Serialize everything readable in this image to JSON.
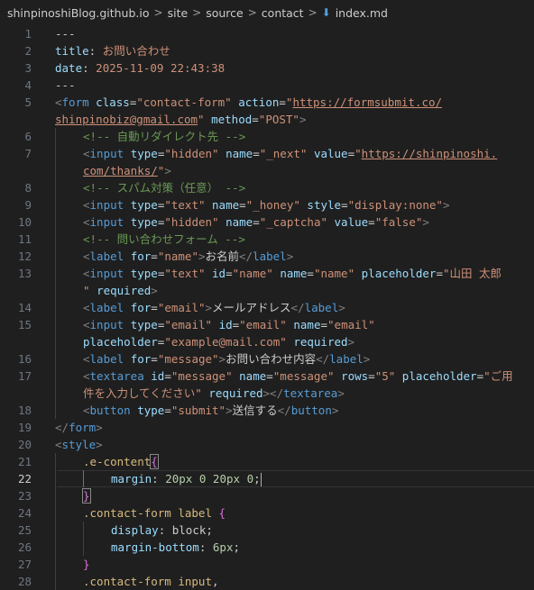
{
  "breadcrumb": {
    "items": [
      "shinpinoshiBlog.github.io",
      "site",
      "source",
      "contact",
      "index.md"
    ],
    "separator": ">",
    "file_icon": "markdown-icon"
  },
  "editor": {
    "current_line": 22,
    "lines": [
      {
        "n": "1",
        "indent": 0,
        "tokens": [
          [
            "---",
            "default"
          ]
        ]
      },
      {
        "n": "2",
        "indent": 0,
        "tokens": [
          [
            "title",
            "key"
          ],
          [
            ": ",
            "default"
          ],
          [
            "お問い合わせ",
            "str"
          ]
        ]
      },
      {
        "n": "3",
        "indent": 0,
        "tokens": [
          [
            "date",
            "key"
          ],
          [
            ": ",
            "default"
          ],
          [
            "2025-11-09 22:43:38",
            "str"
          ]
        ]
      },
      {
        "n": "4",
        "indent": 0,
        "tokens": [
          [
            "---",
            "default"
          ]
        ]
      },
      {
        "n": "5",
        "indent": 0,
        "tokens": [
          [
            "<",
            "br"
          ],
          [
            "form",
            "tag"
          ],
          [
            " ",
            "default"
          ],
          [
            "class",
            "attr"
          ],
          [
            "=",
            "eq"
          ],
          [
            "\"contact-form\"",
            "str"
          ],
          [
            " ",
            "default"
          ],
          [
            "action",
            "attr"
          ],
          [
            "=",
            "eq"
          ],
          [
            "\"",
            "str"
          ],
          [
            "https://formsubmit.co/",
            "url"
          ]
        ]
      },
      {
        "n": "",
        "indent": 0,
        "tokens": [
          [
            "shinpinobiz@gmail.com",
            "url"
          ],
          [
            "\"",
            "str"
          ],
          [
            " ",
            "default"
          ],
          [
            "method",
            "attr"
          ],
          [
            "=",
            "eq"
          ],
          [
            "\"POST\"",
            "str"
          ],
          [
            ">",
            "br"
          ]
        ]
      },
      {
        "n": "6",
        "indent": 1,
        "tokens": [
          [
            "<!-- 自動リダイレクト先 -->",
            "comment"
          ]
        ]
      },
      {
        "n": "7",
        "indent": 1,
        "tokens": [
          [
            "<",
            "br"
          ],
          [
            "input",
            "tag"
          ],
          [
            " ",
            "default"
          ],
          [
            "type",
            "attr"
          ],
          [
            "=",
            "eq"
          ],
          [
            "\"hidden\"",
            "str"
          ],
          [
            " ",
            "default"
          ],
          [
            "name",
            "attr"
          ],
          [
            "=",
            "eq"
          ],
          [
            "\"_next\"",
            "str"
          ],
          [
            " ",
            "default"
          ],
          [
            "value",
            "attr"
          ],
          [
            "=",
            "eq"
          ],
          [
            "\"",
            "str"
          ],
          [
            "https://shinpinoshi.",
            "url"
          ]
        ]
      },
      {
        "n": "",
        "indent": 1,
        "tokens": [
          [
            "com/thanks/",
            "url"
          ],
          [
            "\"",
            "str"
          ],
          [
            ">",
            "br"
          ]
        ]
      },
      {
        "n": "8",
        "indent": 1,
        "tokens": [
          [
            "<!-- スパム対策（任意） -->",
            "comment"
          ]
        ]
      },
      {
        "n": "9",
        "indent": 1,
        "tokens": [
          [
            "<",
            "br"
          ],
          [
            "input",
            "tag"
          ],
          [
            " ",
            "default"
          ],
          [
            "type",
            "attr"
          ],
          [
            "=",
            "eq"
          ],
          [
            "\"text\"",
            "str"
          ],
          [
            " ",
            "default"
          ],
          [
            "name",
            "attr"
          ],
          [
            "=",
            "eq"
          ],
          [
            "\"_honey\"",
            "str"
          ],
          [
            " ",
            "default"
          ],
          [
            "style",
            "attr"
          ],
          [
            "=",
            "eq"
          ],
          [
            "\"display:none\"",
            "str"
          ],
          [
            ">",
            "br"
          ]
        ]
      },
      {
        "n": "10",
        "indent": 1,
        "tokens": [
          [
            "<",
            "br"
          ],
          [
            "input",
            "tag"
          ],
          [
            " ",
            "default"
          ],
          [
            "type",
            "attr"
          ],
          [
            "=",
            "eq"
          ],
          [
            "\"hidden\"",
            "str"
          ],
          [
            " ",
            "default"
          ],
          [
            "name",
            "attr"
          ],
          [
            "=",
            "eq"
          ],
          [
            "\"_captcha\"",
            "str"
          ],
          [
            " ",
            "default"
          ],
          [
            "value",
            "attr"
          ],
          [
            "=",
            "eq"
          ],
          [
            "\"false\"",
            "str"
          ],
          [
            ">",
            "br"
          ]
        ]
      },
      {
        "n": "11",
        "indent": 1,
        "tokens": [
          [
            "<!-- 問い合わせフォーム -->",
            "comment"
          ]
        ]
      },
      {
        "n": "12",
        "indent": 1,
        "tokens": [
          [
            "<",
            "br"
          ],
          [
            "label",
            "tag"
          ],
          [
            " ",
            "default"
          ],
          [
            "for",
            "attr"
          ],
          [
            "=",
            "eq"
          ],
          [
            "\"name\"",
            "str"
          ],
          [
            ">",
            "br"
          ],
          [
            "お名前",
            "default"
          ],
          [
            "</",
            "br"
          ],
          [
            "label",
            "tag"
          ],
          [
            ">",
            "br"
          ]
        ]
      },
      {
        "n": "13",
        "indent": 1,
        "tokens": [
          [
            "<",
            "br"
          ],
          [
            "input",
            "tag"
          ],
          [
            " ",
            "default"
          ],
          [
            "type",
            "attr"
          ],
          [
            "=",
            "eq"
          ],
          [
            "\"text\"",
            "str"
          ],
          [
            " ",
            "default"
          ],
          [
            "id",
            "attr"
          ],
          [
            "=",
            "eq"
          ],
          [
            "\"name\"",
            "str"
          ],
          [
            " ",
            "default"
          ],
          [
            "name",
            "attr"
          ],
          [
            "=",
            "eq"
          ],
          [
            "\"name\"",
            "str"
          ],
          [
            " ",
            "default"
          ],
          [
            "placeholder",
            "attr"
          ],
          [
            "=",
            "eq"
          ],
          [
            "\"山田 太郎",
            "str"
          ]
        ]
      },
      {
        "n": "",
        "indent": 1,
        "tokens": [
          [
            "\"",
            "str"
          ],
          [
            " ",
            "default"
          ],
          [
            "required",
            "attr"
          ],
          [
            ">",
            "br"
          ]
        ]
      },
      {
        "n": "14",
        "indent": 1,
        "tokens": [
          [
            "<",
            "br"
          ],
          [
            "label",
            "tag"
          ],
          [
            " ",
            "default"
          ],
          [
            "for",
            "attr"
          ],
          [
            "=",
            "eq"
          ],
          [
            "\"email\"",
            "str"
          ],
          [
            ">",
            "br"
          ],
          [
            "メールアドレス",
            "default"
          ],
          [
            "</",
            "br"
          ],
          [
            "label",
            "tag"
          ],
          [
            ">",
            "br"
          ]
        ]
      },
      {
        "n": "15",
        "indent": 1,
        "tokens": [
          [
            "<",
            "br"
          ],
          [
            "input",
            "tag"
          ],
          [
            " ",
            "default"
          ],
          [
            "type",
            "attr"
          ],
          [
            "=",
            "eq"
          ],
          [
            "\"email\"",
            "str"
          ],
          [
            " ",
            "default"
          ],
          [
            "id",
            "attr"
          ],
          [
            "=",
            "eq"
          ],
          [
            "\"email\"",
            "str"
          ],
          [
            " ",
            "default"
          ],
          [
            "name",
            "attr"
          ],
          [
            "=",
            "eq"
          ],
          [
            "\"email\"",
            "str"
          ]
        ]
      },
      {
        "n": "",
        "indent": 1,
        "tokens": [
          [
            "placeholder",
            "attr"
          ],
          [
            "=",
            "eq"
          ],
          [
            "\"example@mail.com\"",
            "str"
          ],
          [
            " ",
            "default"
          ],
          [
            "required",
            "attr"
          ],
          [
            ">",
            "br"
          ]
        ]
      },
      {
        "n": "16",
        "indent": 1,
        "tokens": [
          [
            "<",
            "br"
          ],
          [
            "label",
            "tag"
          ],
          [
            " ",
            "default"
          ],
          [
            "for",
            "attr"
          ],
          [
            "=",
            "eq"
          ],
          [
            "\"message\"",
            "str"
          ],
          [
            ">",
            "br"
          ],
          [
            "お問い合わせ内容",
            "default"
          ],
          [
            "</",
            "br"
          ],
          [
            "label",
            "tag"
          ],
          [
            ">",
            "br"
          ]
        ]
      },
      {
        "n": "17",
        "indent": 1,
        "tokens": [
          [
            "<",
            "br"
          ],
          [
            "textarea",
            "tag"
          ],
          [
            " ",
            "default"
          ],
          [
            "id",
            "attr"
          ],
          [
            "=",
            "eq"
          ],
          [
            "\"message\"",
            "str"
          ],
          [
            " ",
            "default"
          ],
          [
            "name",
            "attr"
          ],
          [
            "=",
            "eq"
          ],
          [
            "\"message\"",
            "str"
          ],
          [
            " ",
            "default"
          ],
          [
            "rows",
            "attr"
          ],
          [
            "=",
            "eq"
          ],
          [
            "\"5\"",
            "str"
          ],
          [
            " ",
            "default"
          ],
          [
            "placeholder",
            "attr"
          ],
          [
            "=",
            "eq"
          ],
          [
            "\"ご用",
            "str"
          ]
        ]
      },
      {
        "n": "",
        "indent": 1,
        "tokens": [
          [
            "件を入力してください\"",
            "str"
          ],
          [
            " ",
            "default"
          ],
          [
            "required",
            "attr"
          ],
          [
            "></",
            "br"
          ],
          [
            "textarea",
            "tag"
          ],
          [
            ">",
            "br"
          ]
        ]
      },
      {
        "n": "18",
        "indent": 1,
        "tokens": [
          [
            "<",
            "br"
          ],
          [
            "button",
            "tag"
          ],
          [
            " ",
            "default"
          ],
          [
            "type",
            "attr"
          ],
          [
            "=",
            "eq"
          ],
          [
            "\"submit\"",
            "str"
          ],
          [
            ">",
            "br"
          ],
          [
            "送信する",
            "default"
          ],
          [
            "</",
            "br"
          ],
          [
            "button",
            "tag"
          ],
          [
            ">",
            "br"
          ]
        ]
      },
      {
        "n": "19",
        "indent": 0,
        "tokens": [
          [
            "</",
            "br"
          ],
          [
            "form",
            "tag"
          ],
          [
            ">",
            "br"
          ]
        ]
      },
      {
        "n": "20",
        "indent": 0,
        "tokens": [
          [
            "<",
            "br"
          ],
          [
            "style",
            "tag"
          ],
          [
            ">",
            "br"
          ]
        ]
      },
      {
        "n": "21",
        "indent": 1,
        "tokens": [
          [
            ".e-content",
            "sel"
          ],
          [
            "{",
            "brace-hl"
          ]
        ]
      },
      {
        "n": "22",
        "indent": 2,
        "tokens": [
          [
            "margin",
            "prop"
          ],
          [
            ": ",
            "default"
          ],
          [
            "20px",
            "num"
          ],
          [
            " ",
            "default"
          ],
          [
            "0",
            "num"
          ],
          [
            " ",
            "default"
          ],
          [
            "20px",
            "num"
          ],
          [
            " ",
            "default"
          ],
          [
            "0",
            "num"
          ],
          [
            ";",
            "default"
          ],
          [
            "",
            "cursor"
          ]
        ]
      },
      {
        "n": "23",
        "indent": 1,
        "tokens": [
          [
            "}",
            "brace-hl"
          ]
        ]
      },
      {
        "n": "24",
        "indent": 1,
        "tokens": [
          [
            ".contact-form label",
            "sel"
          ],
          [
            " ",
            "default"
          ],
          [
            "{",
            "brace"
          ]
        ]
      },
      {
        "n": "25",
        "indent": 2,
        "tokens": [
          [
            "display",
            "prop"
          ],
          [
            ": ",
            "default"
          ],
          [
            "block",
            "default"
          ],
          [
            ";",
            "default"
          ]
        ]
      },
      {
        "n": "26",
        "indent": 2,
        "tokens": [
          [
            "margin-bottom",
            "prop"
          ],
          [
            ": ",
            "default"
          ],
          [
            "6px",
            "num"
          ],
          [
            ";",
            "default"
          ]
        ]
      },
      {
        "n": "27",
        "indent": 1,
        "tokens": [
          [
            "}",
            "brace"
          ]
        ]
      },
      {
        "n": "28",
        "indent": 1,
        "tokens": [
          [
            ".contact-form input",
            "sel"
          ],
          [
            ",",
            "default"
          ]
        ]
      }
    ]
  }
}
